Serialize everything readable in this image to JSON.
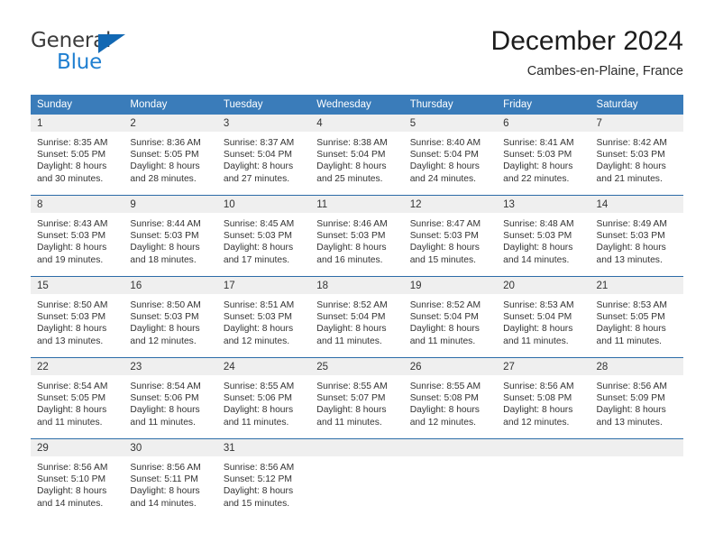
{
  "brand": {
    "name_part1": "General",
    "name_part2": "Blue",
    "colors": {
      "dark": "#3c3c3c",
      "blue": "#1f7fd1",
      "triangle": "#1268b3"
    }
  },
  "header": {
    "title": "December 2024",
    "location": "Cambes-en-Plaine, France"
  },
  "theme": {
    "header_row_bg": "#3a7cba",
    "header_row_text": "#ffffff",
    "daynum_band_bg": "#efefef",
    "row_divider": "#2c6ca8",
    "body_text": "#333333"
  },
  "weekdays": [
    "Sunday",
    "Monday",
    "Tuesday",
    "Wednesday",
    "Thursday",
    "Friday",
    "Saturday"
  ],
  "weeks": [
    [
      {
        "day": "1",
        "sunrise": "Sunrise: 8:35 AM",
        "sunset": "Sunset: 5:05 PM",
        "daylight_line1": "Daylight: 8 hours",
        "daylight_line2": "and 30 minutes."
      },
      {
        "day": "2",
        "sunrise": "Sunrise: 8:36 AM",
        "sunset": "Sunset: 5:05 PM",
        "daylight_line1": "Daylight: 8 hours",
        "daylight_line2": "and 28 minutes."
      },
      {
        "day": "3",
        "sunrise": "Sunrise: 8:37 AM",
        "sunset": "Sunset: 5:04 PM",
        "daylight_line1": "Daylight: 8 hours",
        "daylight_line2": "and 27 minutes."
      },
      {
        "day": "4",
        "sunrise": "Sunrise: 8:38 AM",
        "sunset": "Sunset: 5:04 PM",
        "daylight_line1": "Daylight: 8 hours",
        "daylight_line2": "and 25 minutes."
      },
      {
        "day": "5",
        "sunrise": "Sunrise: 8:40 AM",
        "sunset": "Sunset: 5:04 PM",
        "daylight_line1": "Daylight: 8 hours",
        "daylight_line2": "and 24 minutes."
      },
      {
        "day": "6",
        "sunrise": "Sunrise: 8:41 AM",
        "sunset": "Sunset: 5:03 PM",
        "daylight_line1": "Daylight: 8 hours",
        "daylight_line2": "and 22 minutes."
      },
      {
        "day": "7",
        "sunrise": "Sunrise: 8:42 AM",
        "sunset": "Sunset: 5:03 PM",
        "daylight_line1": "Daylight: 8 hours",
        "daylight_line2": "and 21 minutes."
      }
    ],
    [
      {
        "day": "8",
        "sunrise": "Sunrise: 8:43 AM",
        "sunset": "Sunset: 5:03 PM",
        "daylight_line1": "Daylight: 8 hours",
        "daylight_line2": "and 19 minutes."
      },
      {
        "day": "9",
        "sunrise": "Sunrise: 8:44 AM",
        "sunset": "Sunset: 5:03 PM",
        "daylight_line1": "Daylight: 8 hours",
        "daylight_line2": "and 18 minutes."
      },
      {
        "day": "10",
        "sunrise": "Sunrise: 8:45 AM",
        "sunset": "Sunset: 5:03 PM",
        "daylight_line1": "Daylight: 8 hours",
        "daylight_line2": "and 17 minutes."
      },
      {
        "day": "11",
        "sunrise": "Sunrise: 8:46 AM",
        "sunset": "Sunset: 5:03 PM",
        "daylight_line1": "Daylight: 8 hours",
        "daylight_line2": "and 16 minutes."
      },
      {
        "day": "12",
        "sunrise": "Sunrise: 8:47 AM",
        "sunset": "Sunset: 5:03 PM",
        "daylight_line1": "Daylight: 8 hours",
        "daylight_line2": "and 15 minutes."
      },
      {
        "day": "13",
        "sunrise": "Sunrise: 8:48 AM",
        "sunset": "Sunset: 5:03 PM",
        "daylight_line1": "Daylight: 8 hours",
        "daylight_line2": "and 14 minutes."
      },
      {
        "day": "14",
        "sunrise": "Sunrise: 8:49 AM",
        "sunset": "Sunset: 5:03 PM",
        "daylight_line1": "Daylight: 8 hours",
        "daylight_line2": "and 13 minutes."
      }
    ],
    [
      {
        "day": "15",
        "sunrise": "Sunrise: 8:50 AM",
        "sunset": "Sunset: 5:03 PM",
        "daylight_line1": "Daylight: 8 hours",
        "daylight_line2": "and 13 minutes."
      },
      {
        "day": "16",
        "sunrise": "Sunrise: 8:50 AM",
        "sunset": "Sunset: 5:03 PM",
        "daylight_line1": "Daylight: 8 hours",
        "daylight_line2": "and 12 minutes."
      },
      {
        "day": "17",
        "sunrise": "Sunrise: 8:51 AM",
        "sunset": "Sunset: 5:03 PM",
        "daylight_line1": "Daylight: 8 hours",
        "daylight_line2": "and 12 minutes."
      },
      {
        "day": "18",
        "sunrise": "Sunrise: 8:52 AM",
        "sunset": "Sunset: 5:04 PM",
        "daylight_line1": "Daylight: 8 hours",
        "daylight_line2": "and 11 minutes."
      },
      {
        "day": "19",
        "sunrise": "Sunrise: 8:52 AM",
        "sunset": "Sunset: 5:04 PM",
        "daylight_line1": "Daylight: 8 hours",
        "daylight_line2": "and 11 minutes."
      },
      {
        "day": "20",
        "sunrise": "Sunrise: 8:53 AM",
        "sunset": "Sunset: 5:04 PM",
        "daylight_line1": "Daylight: 8 hours",
        "daylight_line2": "and 11 minutes."
      },
      {
        "day": "21",
        "sunrise": "Sunrise: 8:53 AM",
        "sunset": "Sunset: 5:05 PM",
        "daylight_line1": "Daylight: 8 hours",
        "daylight_line2": "and 11 minutes."
      }
    ],
    [
      {
        "day": "22",
        "sunrise": "Sunrise: 8:54 AM",
        "sunset": "Sunset: 5:05 PM",
        "daylight_line1": "Daylight: 8 hours",
        "daylight_line2": "and 11 minutes."
      },
      {
        "day": "23",
        "sunrise": "Sunrise: 8:54 AM",
        "sunset": "Sunset: 5:06 PM",
        "daylight_line1": "Daylight: 8 hours",
        "daylight_line2": "and 11 minutes."
      },
      {
        "day": "24",
        "sunrise": "Sunrise: 8:55 AM",
        "sunset": "Sunset: 5:06 PM",
        "daylight_line1": "Daylight: 8 hours",
        "daylight_line2": "and 11 minutes."
      },
      {
        "day": "25",
        "sunrise": "Sunrise: 8:55 AM",
        "sunset": "Sunset: 5:07 PM",
        "daylight_line1": "Daylight: 8 hours",
        "daylight_line2": "and 11 minutes."
      },
      {
        "day": "26",
        "sunrise": "Sunrise: 8:55 AM",
        "sunset": "Sunset: 5:08 PM",
        "daylight_line1": "Daylight: 8 hours",
        "daylight_line2": "and 12 minutes."
      },
      {
        "day": "27",
        "sunrise": "Sunrise: 8:56 AM",
        "sunset": "Sunset: 5:08 PM",
        "daylight_line1": "Daylight: 8 hours",
        "daylight_line2": "and 12 minutes."
      },
      {
        "day": "28",
        "sunrise": "Sunrise: 8:56 AM",
        "sunset": "Sunset: 5:09 PM",
        "daylight_line1": "Daylight: 8 hours",
        "daylight_line2": "and 13 minutes."
      }
    ],
    [
      {
        "day": "29",
        "sunrise": "Sunrise: 8:56 AM",
        "sunset": "Sunset: 5:10 PM",
        "daylight_line1": "Daylight: 8 hours",
        "daylight_line2": "and 14 minutes."
      },
      {
        "day": "30",
        "sunrise": "Sunrise: 8:56 AM",
        "sunset": "Sunset: 5:11 PM",
        "daylight_line1": "Daylight: 8 hours",
        "daylight_line2": "and 14 minutes."
      },
      {
        "day": "31",
        "sunrise": "Sunrise: 8:56 AM",
        "sunset": "Sunset: 5:12 PM",
        "daylight_line1": "Daylight: 8 hours",
        "daylight_line2": "and 15 minutes."
      },
      {
        "day": "",
        "sunrise": "",
        "sunset": "",
        "daylight_line1": "",
        "daylight_line2": ""
      },
      {
        "day": "",
        "sunrise": "",
        "sunset": "",
        "daylight_line1": "",
        "daylight_line2": ""
      },
      {
        "day": "",
        "sunrise": "",
        "sunset": "",
        "daylight_line1": "",
        "daylight_line2": ""
      },
      {
        "day": "",
        "sunrise": "",
        "sunset": "",
        "daylight_line1": "",
        "daylight_line2": ""
      }
    ]
  ]
}
